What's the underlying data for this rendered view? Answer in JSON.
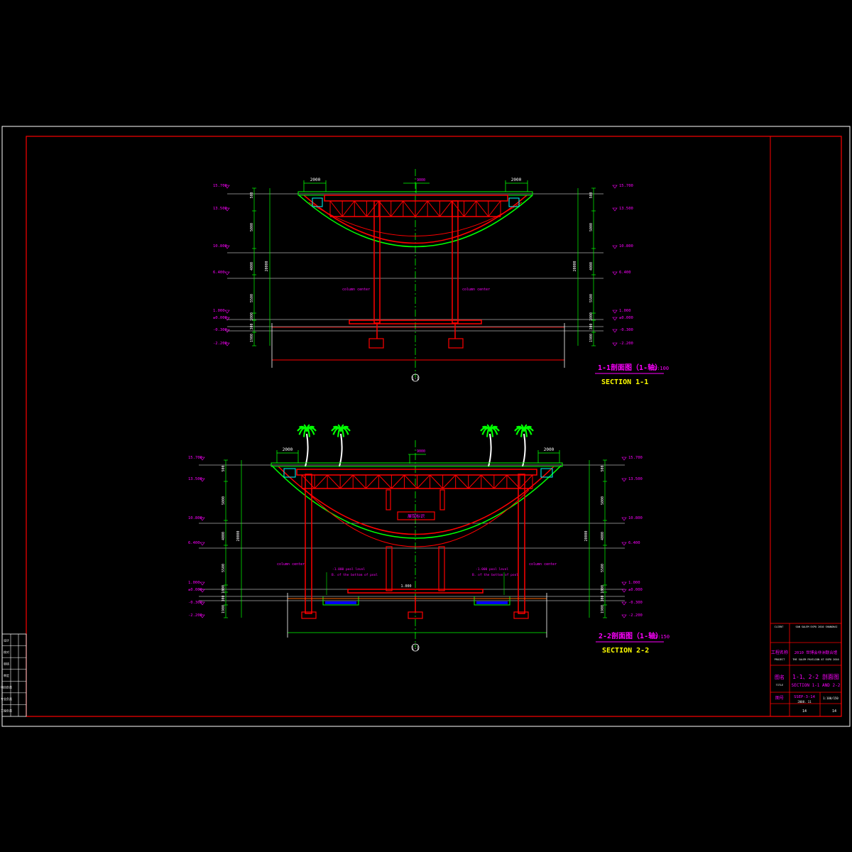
{
  "colors": {
    "background": "#000000",
    "frame": "#ffffff",
    "border": "#ff0000",
    "structure": "#ff0000",
    "dimension": "#00ff00",
    "text_magenta": "#ff00ff",
    "text_yellow": "#ffff00",
    "text_white": "#ffffff",
    "water": "#0000ff",
    "foliage": "#00ff00"
  },
  "section1": {
    "title_cn": "1-1剖面图（1-轴）",
    "scale": "1:100",
    "title_en": "SECTION 1-1",
    "axis_label": "1-1",
    "top_dims": [
      "2000",
      "2000"
    ],
    "center_tag": "9000",
    "levels_left": [
      "15.700",
      "13.500",
      "10.800",
      "6.400",
      "1.000",
      "±0.000",
      "-0.300",
      "-2.200"
    ],
    "levels_right": [
      "15.700",
      "13.500",
      "10.800",
      "6.400",
      "1.000",
      "±0.000",
      "-0.300",
      "-2.200"
    ],
    "vdims_left": [
      "500",
      "5000",
      "4000",
      "5500",
      "1000",
      "300",
      "1900",
      "20000"
    ],
    "vdims_right": [
      "500",
      "5000",
      "4000",
      "5500",
      "1000",
      "300",
      "1900",
      "20000"
    ],
    "column_notes": [
      "column center",
      "column center"
    ]
  },
  "section2": {
    "title_cn": "2-2剖面图（1-轴）",
    "scale": "1:150",
    "title_en": "SECTION 2-2",
    "axis_label": "1-1",
    "top_dims": [
      "2000",
      "2000"
    ],
    "center_tag": "9000",
    "sign_text": "展馆标识",
    "levels_left": [
      "15.700",
      "13.500",
      "10.800",
      "6.400",
      "1.000",
      "±0.000",
      "-0.300",
      "-2.200"
    ],
    "levels_right": [
      "15.700",
      "13.500",
      "10.800",
      "6.400",
      "1.000",
      "±0.000",
      "-0.300",
      "-2.200"
    ],
    "vdims_left": [
      "500",
      "5000",
      "4000",
      "5500",
      "1000",
      "300",
      "1900",
      "20000"
    ],
    "vdims_right": [
      "500",
      "5000",
      "4000",
      "5500",
      "1000",
      "300",
      "1900",
      "20000"
    ],
    "pool_notes": [
      "-1.000 pool level",
      "-1.000 pool level"
    ],
    "bottom_notes": [
      "B. of the bottom of pool",
      "B. of the bottom of pool"
    ],
    "column_notes": [
      "column center",
      "column center"
    ],
    "floor_level": "1.000"
  },
  "title_block": {
    "client": "SAN SALEM EXPO 2010 SHANGHAI",
    "project_cn": "2010 世博会非洲联合馆",
    "project_en": "THE SALEM PAVILION AT EXPO 2010",
    "project_label_cn": "工程名称",
    "project_label_en": "PROJECT",
    "drawing_label_cn": "图名",
    "drawing_label_en": "TITLE",
    "drawing_title_cn": "1-1、2-2 剖面图",
    "drawing_title_en": "SECTION 1-1 AND 2-2",
    "drawing_no_label": "图号",
    "drawing_no": "SSEP-3-14",
    "date": "2008. 11",
    "scale": "1:100/150",
    "sheet": "14"
  },
  "revision_block": {
    "rows": [
      "设计",
      "校对",
      "审核",
      "审定",
      "项目负责",
      "专业负责",
      "工程负责"
    ]
  }
}
